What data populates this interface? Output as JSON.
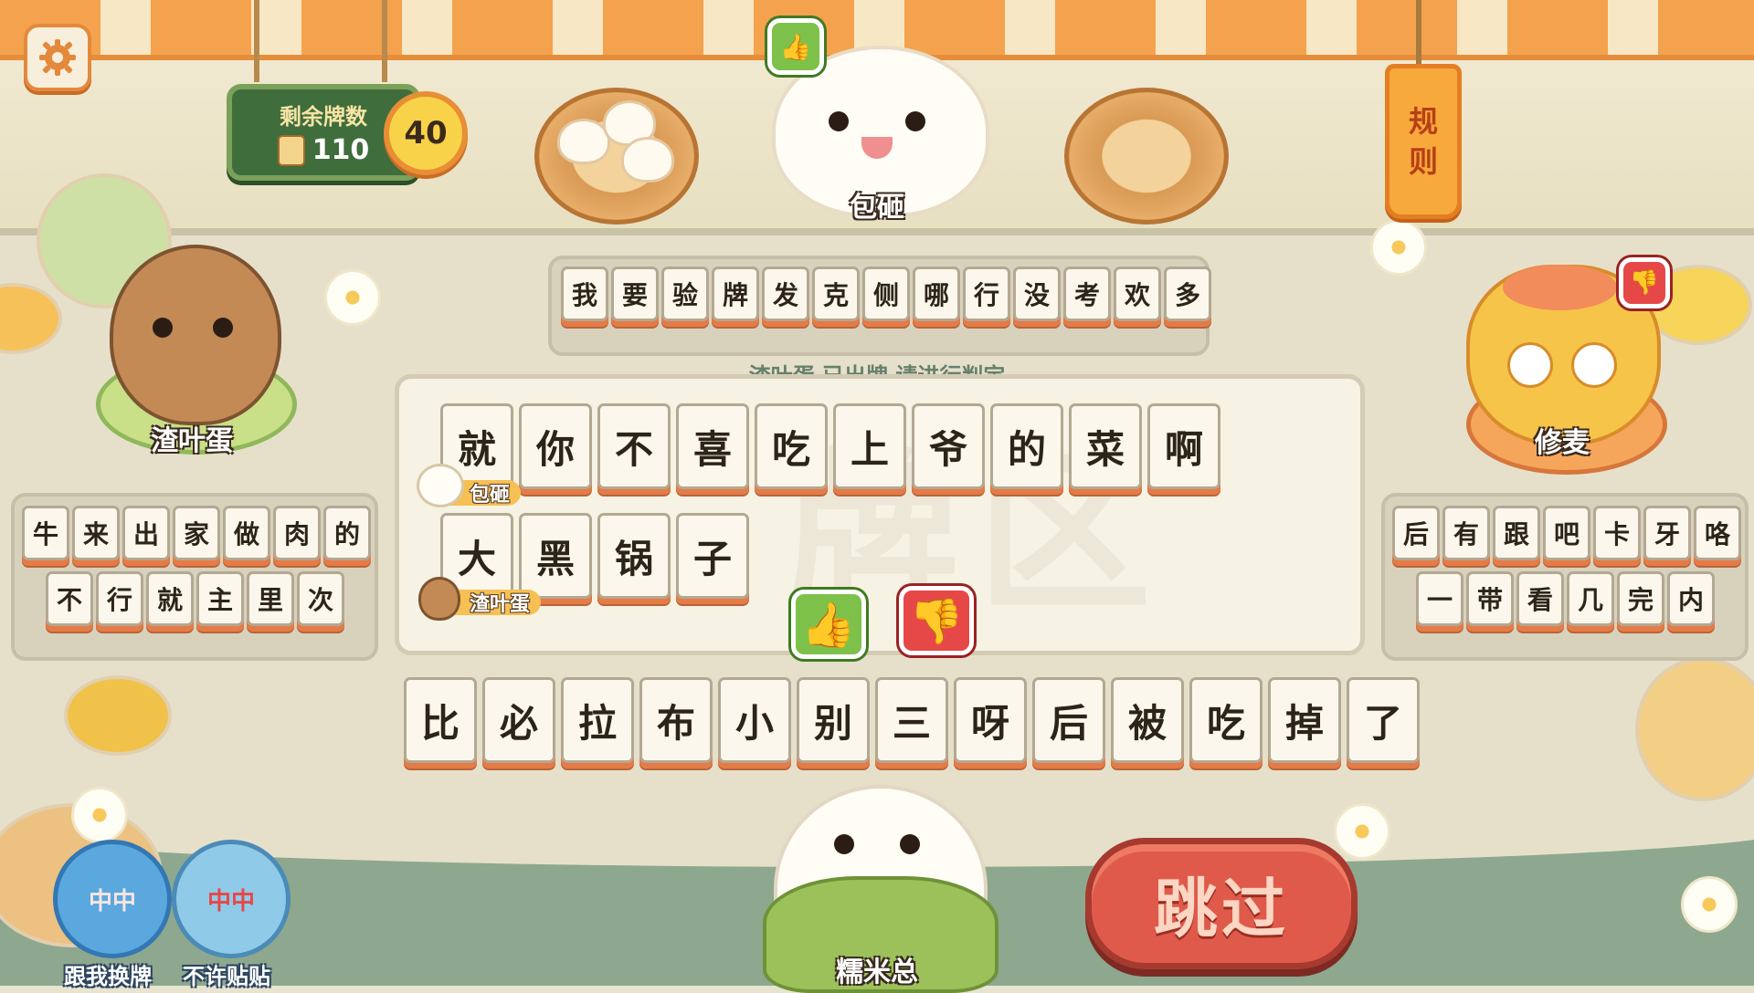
{
  "hud": {
    "remaining_label": "剩余牌数",
    "remaining_count": "110",
    "timer": "40",
    "rules_chars": [
      "规",
      "则"
    ]
  },
  "players": {
    "top": {
      "name": "包砸"
    },
    "left": {
      "name": "渣叶蛋"
    },
    "right": {
      "name": "修麦"
    },
    "self": {
      "name": "糯米总"
    }
  },
  "hands": {
    "top": [
      "我",
      "要",
      "验",
      "牌",
      "发",
      "克",
      "侧",
      "哪",
      "行",
      "没",
      "考",
      "欢",
      "多"
    ],
    "left_row1": [
      "牛",
      "来",
      "出",
      "家",
      "做",
      "肉",
      "的"
    ],
    "left_row2": [
      "不",
      "行",
      "就",
      "主",
      "里",
      "次"
    ],
    "right_row1": [
      "后",
      "有",
      "跟",
      "吧",
      "卡",
      "牙",
      "咯"
    ],
    "right_row2": [
      "一",
      "带",
      "看",
      "几",
      "完",
      "内"
    ],
    "self": [
      "比",
      "必",
      "拉",
      "布",
      "小",
      "别",
      "三",
      "呀",
      "后",
      "被",
      "吃",
      "掉",
      "了"
    ]
  },
  "play_area": {
    "status": "渣叶蛋 已出牌 请进行判定",
    "watermark": "牌区",
    "plays": [
      {
        "owner": "包砸",
        "tiles": [
          "就",
          "你",
          "不",
          "喜",
          "吃",
          "上",
          "爷",
          "的",
          "菜",
          "啊"
        ]
      },
      {
        "owner": "渣叶蛋",
        "tiles": [
          "大",
          "黑",
          "锅",
          "子"
        ]
      }
    ]
  },
  "actions": {
    "skip_label": "跳过",
    "swap_label": "跟我换牌",
    "no_stick_label": "不许贴贴",
    "swap_icon_text": "中中",
    "no_stick_icon_text": "中中"
  },
  "icons": {
    "settings": "gear-icon",
    "thumb_up": "thumb-up-icon",
    "thumb_down": "thumb-down-icon"
  },
  "colors": {
    "accent_orange": "#e4893c",
    "tile_edge": "#e57b47",
    "skip_red": "#e05a4b",
    "thumb_green": "#7dc14a",
    "thumb_red": "#e64848"
  }
}
